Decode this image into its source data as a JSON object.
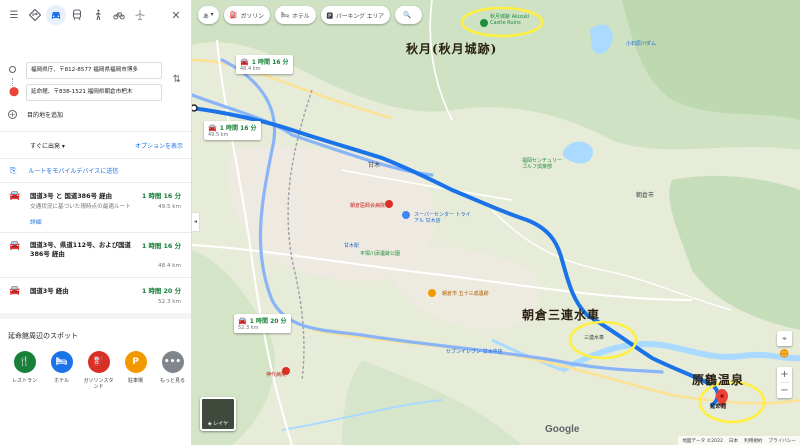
{
  "panel": {
    "modes": [
      {
        "name": "directions-mode-best",
        "icon": "diamond-route-icon"
      },
      {
        "name": "directions-mode-car",
        "icon": "car-icon"
      },
      {
        "name": "directions-mode-transit",
        "icon": "train-icon"
      },
      {
        "name": "directions-mode-walk",
        "icon": "walk-icon"
      },
      {
        "name": "directions-mode-bike",
        "icon": "bike-icon"
      },
      {
        "name": "directions-mode-flight",
        "icon": "plane-icon"
      }
    ],
    "origin": "福岡県庁、〒812-8577 福岡県福岡市博多",
    "destination": "延命館、〒838-1521 福岡県朝倉市杷木",
    "add_destination": "目的地を追加",
    "depart_now": "すぐに出発",
    "options": "オプションを表示",
    "send_to_device": "ルートをモバイルデバイスに送信",
    "routes": [
      {
        "title": "国道3号 と 国道386号 経由",
        "time": "1 時間 16 分",
        "sub": "交通状況に基づいた現時点の最適ルート",
        "distance": "49.5 km",
        "details": "詳細"
      },
      {
        "title": "国道3号、県道112号、および国道386号 経由",
        "time": "1 時間 16 分",
        "distance": "48.4 km"
      },
      {
        "title": "国道3号 経由",
        "time": "1 時間 20 分",
        "distance": "52.3 km"
      }
    ],
    "nearby_title": "延命館周辺のスポット",
    "spots": [
      {
        "label": "レストラン",
        "color": "#188038",
        "glyph": "🍴"
      },
      {
        "label": "ホテル",
        "color": "#1a73e8",
        "glyph": "🛏"
      },
      {
        "label": "ガソリンスタンド",
        "color": "#d93025",
        "glyph": "⛽"
      },
      {
        "label": "駐車場",
        "color": "#f29900",
        "glyph": "P"
      },
      {
        "label": "もっと見る",
        "color": "#80868b",
        "glyph": "•••"
      }
    ]
  },
  "map": {
    "chips": {
      "lang": "あ",
      "gas": "ガソリン",
      "hotel": "ホテル",
      "parking": "パーキング エリア"
    },
    "route_boxes": [
      {
        "time": "1 時間 16 分",
        "dist": "48.4 km"
      },
      {
        "time": "1 時間 16 分",
        "dist": "49.5 km"
      },
      {
        "time": "1 時間 20 分",
        "dist": "52.3 km"
      }
    ],
    "annotations": {
      "akizuki": "秋月(秋月城跡)",
      "mizuguruma": "朝倉三連水車",
      "harazuru": "原鶴温泉"
    },
    "poi_labels": {
      "castle": "秋月城跡 Akizuki Castle Ruins",
      "kokoro": "小石原川ダム",
      "asakura": "朝倉市",
      "amagi": "甘木駅",
      "station_area": "甘木",
      "dest": "延命館",
      "hospital": "朝倉医師会病院",
      "supercenter": "スーパーセンター トライアル 甘木店",
      "seven": "セブンイレブン 甘木中店",
      "renkei": "三連水車",
      "kinshi": "神代病院",
      "gc": "福岡センチュリー ゴルフ倶楽部",
      "hitomaru": "平塚川添遺跡公園",
      "ebisu": "朝倉市 五十三成遺跡"
    },
    "layer_label": "レイヤ",
    "google": "Google",
    "attribution": [
      "地図データ ©2022",
      "日本",
      "利用規約",
      "プライバシー"
    ]
  }
}
